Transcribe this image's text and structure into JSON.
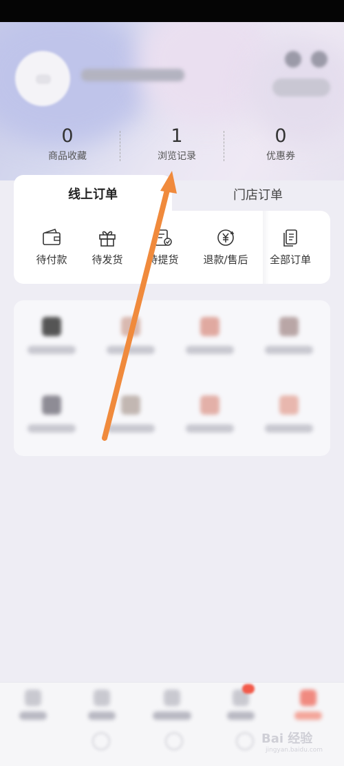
{
  "stats": [
    {
      "value": "0",
      "label": "商品收藏"
    },
    {
      "value": "1",
      "label": "浏览记录"
    },
    {
      "value": "0",
      "label": "优惠券"
    }
  ],
  "order_tabs": {
    "active": "线上订单",
    "inactive": "门店订单"
  },
  "order_items": [
    {
      "label": "待付款",
      "icon": "wallet-icon"
    },
    {
      "label": "待发货",
      "icon": "gift-icon"
    },
    {
      "label": "待提货",
      "icon": "pickup-receipt-icon"
    },
    {
      "label": "退款/售后",
      "icon": "refund-yen-icon"
    },
    {
      "label": "全部订单",
      "icon": "all-orders-icon"
    }
  ],
  "watermark": {
    "text": "Bai 经验",
    "sub": "jingyan.baidu.com"
  },
  "colors": {
    "accent": "#f08a3c",
    "background": "#eeedf4",
    "nav_active": "#f25a4a"
  }
}
